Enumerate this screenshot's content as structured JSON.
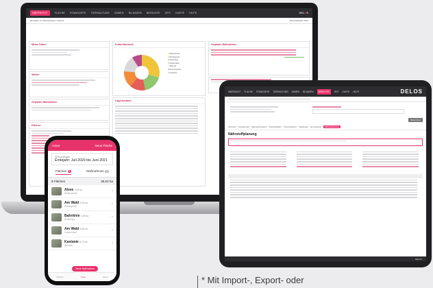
{
  "laptop": {
    "nav": [
      "ÜBERSICHT",
      "FLÄCHE",
      "STANDORTE",
      "TIERHALTUNG",
      "SAMEN",
      "BILANZEN",
      "BERICHTE",
      "ZEIT",
      "KARTE",
      "HILFE"
    ],
    "brand_a": "DEL",
    "brand_b": "O",
    "brand_c": "S",
    "sub_left": "Einstellen von Betriebsliste in Betrieb",
    "sub_right": "Wirtschaftsjahr 2020",
    "panels": {
      "p1": "Meine Daten",
      "p2": "Wetter",
      "p3": "Kulturübersicht",
      "p4": "Geplante Maßnahmen",
      "p5": "Flächen",
      "p6": "Geplante Maßnahmen",
      "p7": "Lagerbestand"
    },
    "pie_legend": [
      "Winterweizen",
      "Wintergerste",
      "Winterraps",
      "Zuckerrüben",
      "Silomais",
      "Sommergerste",
      "Grünland"
    ],
    "colors": {
      "accent": "#e7336b",
      "nav": "#2d2d31"
    }
  },
  "tablet": {
    "nav": [
      "ÜBERSICHT",
      "FLÄCHE",
      "STANDORTE",
      "TIERHALTUNG",
      "SAMEN",
      "BILANZEN",
      "BERICHTE",
      "ZEIT",
      "KARTE",
      "HILFE"
    ],
    "active_index": 6,
    "brand": "DELOS",
    "heading": "Nährstoffplanung",
    "button": "Berechnen",
    "tabs": [
      "Übersicht",
      "Düngebedarf",
      "Nährstoffvergleich",
      "Stickstoffbilanz",
      "Phosphatbilanz",
      "Kalkbedarf",
      "Humusbilanz",
      "Nährstoffplanung"
    ],
    "foot": "DELOS"
  },
  "phone": {
    "header_left": "Acker",
    "header_right": "Neue Fläche",
    "card_caption": "Wirtschaftsjahr",
    "card_value": "Erntejahr: Juli 2020 bis Juni 2021",
    "tab1": "Flächen",
    "tab1_count": "8",
    "tab2": "Maßnahmen",
    "tab2_count": "0",
    "count_left": "8 Flächen",
    "count_right": "38,63 ha",
    "items": [
      {
        "name": "Alsee",
        "size": "4,48 ha",
        "sub": "Winterweizen"
      },
      {
        "name": "Am Wald",
        "size": "2,28 ha",
        "sub": "Wintergerste"
      },
      {
        "name": "Bahnlinie",
        "size": "4,08 ha",
        "sub": "Winterraps"
      },
      {
        "name": "Am Wald",
        "size": "3,48 ha",
        "sub": "Zuckerrüben"
      },
      {
        "name": "Kastanie",
        "size": "5,74 ha",
        "sub": "Silomais"
      }
    ],
    "fab": "Neue Maßnahme",
    "bar": [
      "Flächen",
      "Acker",
      "Menü"
    ]
  },
  "caption": "* Mit Import-, Export- oder"
}
